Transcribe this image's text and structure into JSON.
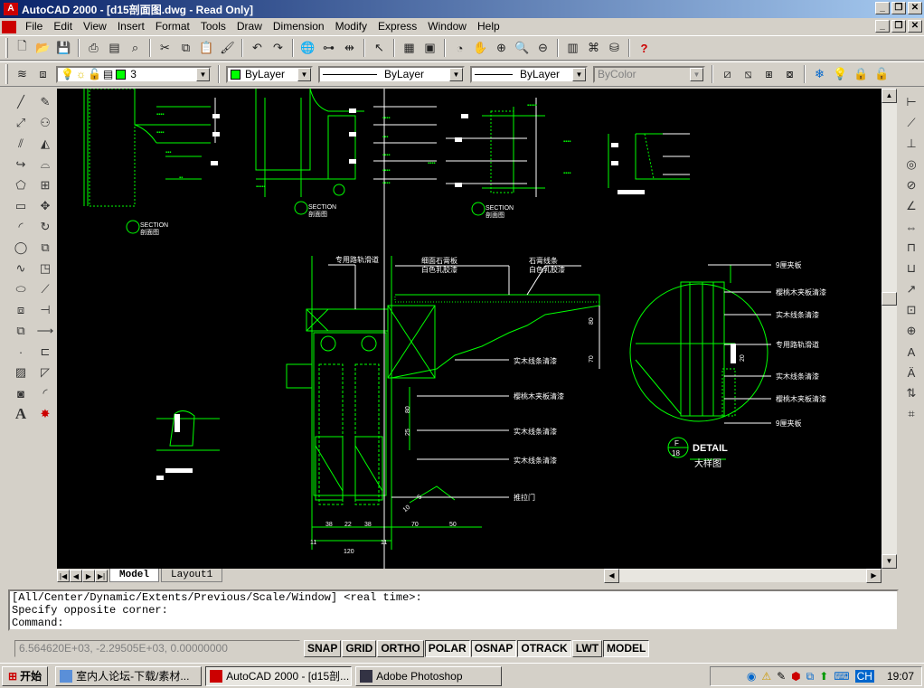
{
  "window": {
    "title": "AutoCAD 2000 - [d15剖面图.dwg - Read Only]",
    "controls": {
      "minimize": "_",
      "restore": "❐",
      "close": "✕"
    }
  },
  "menu": [
    "File",
    "Edit",
    "View",
    "Insert",
    "Format",
    "Tools",
    "Draw",
    "Dimension",
    "Modify",
    "Express",
    "Window",
    "Help"
  ],
  "properties": {
    "layer": "3",
    "color": "ByLayer",
    "linetype": "ByLayer",
    "lineweight": "ByLayer",
    "plotstyle": "ByColor"
  },
  "drawing": {
    "annotations_top_left": [
      "SECTION",
      "剖面图"
    ],
    "annotations_mid": [
      "SECTION",
      "剖面图"
    ],
    "annotations_right": [
      "SECTION",
      "剖面图"
    ],
    "labels_main": [
      "专用路轨滑道",
      "细面石膏板",
      "白色乳胶漆",
      "石膏线条",
      "白色乳胶漆",
      "实木线条清漆",
      "樱桃木夹板清漆",
      "实木线条清漆",
      "实木线条清漆",
      "推拉门"
    ],
    "dims_right": [
      "80",
      "70"
    ],
    "dims_vertical": [
      "80",
      "25"
    ],
    "dims_bottom": [
      "38",
      "22",
      "38",
      "70",
      "50",
      "11",
      "11",
      "120"
    ],
    "dims_diag": [
      "10",
      "5"
    ],
    "detail_labels": [
      "9厘夹板",
      "樱桃木夹板清漆",
      "实木线条清漆",
      "专用路轨滑道",
      "实木线条清漆",
      "樱桃木夹板清漆",
      "9厘夹板"
    ],
    "detail_dim": "20",
    "detail_badge": {
      "top": "F",
      "bottom": "18",
      "title": "DETAIL",
      "subtitle": "大样图"
    }
  },
  "layout_tabs": [
    "Model",
    "Layout1"
  ],
  "command_lines": [
    "[All/Center/Dynamic/Extents/Previous/Scale/Window] <real time>:",
    "Specify opposite corner:",
    "Command:"
  ],
  "status": {
    "coords": "6.564620E+03, -2.29505E+03, 0.00000000",
    "toggles": [
      "SNAP",
      "GRID",
      "ORTHO",
      "POLAR",
      "OSNAP",
      "OTRACK",
      "LWT",
      "MODEL"
    ],
    "active": [
      "POLAR",
      "OSNAP",
      "OTRACK",
      "MODEL"
    ]
  },
  "taskbar": {
    "start": "开始",
    "tasks": [
      "室内人论坛-下载/素材...",
      "AutoCAD 2000 - [d15剖...",
      "Adobe Photoshop"
    ],
    "active_task": 1,
    "tray_extra": "CH",
    "clock": "19:07"
  },
  "colors": {
    "accent": "#0a246a",
    "cad_bg": "#000000",
    "cad_green": "#00ff00",
    "cad_white": "#ffffff"
  }
}
